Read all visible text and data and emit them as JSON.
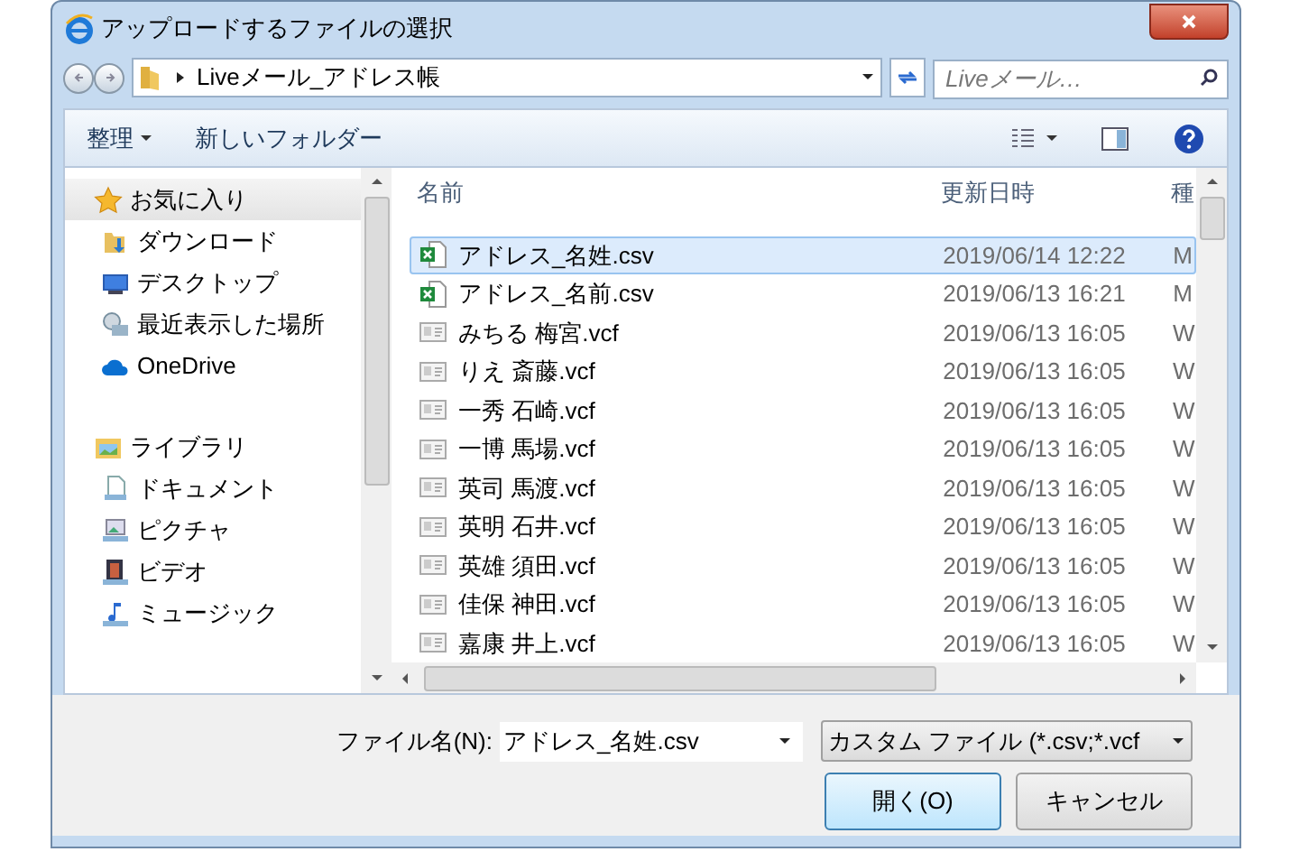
{
  "window": {
    "title": "アップロードするファイルの選択"
  },
  "address": {
    "path": "Liveメール_アドレス帳"
  },
  "search": {
    "placeholder": "Liveメール…"
  },
  "toolbar": {
    "organize": "整理",
    "new_folder": "新しいフォルダー"
  },
  "sidebar": {
    "items": [
      {
        "label": "お気に入り",
        "kind": "star",
        "selected": true,
        "children": [
          {
            "label": "ダウンロード",
            "kind": "download",
            "selected": false
          },
          {
            "label": "デスクトップ",
            "kind": "desktop",
            "selected": false
          },
          {
            "label": "最近表示した場所",
            "kind": "recent",
            "selected": false
          },
          {
            "label": "OneDrive",
            "kind": "cloud",
            "selected": false
          }
        ]
      },
      {
        "label": "ライブラリ",
        "kind": "library",
        "selected": false,
        "children": [
          {
            "label": "ドキュメント",
            "kind": "document",
            "selected": false
          },
          {
            "label": "ピクチャ",
            "kind": "picture",
            "selected": false
          },
          {
            "label": "ビデオ",
            "kind": "video",
            "selected": false
          },
          {
            "label": "ミュージック",
            "kind": "music",
            "selected": false
          }
        ]
      }
    ]
  },
  "table": {
    "columns": [
      "名前",
      "更新日時",
      "種"
    ],
    "rows": [
      {
        "name": "アドレス_名姓.csv",
        "date": "2019/06/14 12:22",
        "column_3": "M",
        "kind": "csv",
        "selected": true
      },
      {
        "name": "アドレス_名前.csv",
        "date": "2019/06/13 16:21",
        "column_3": "M",
        "kind": "csv",
        "selected": false
      },
      {
        "name": "みちる 梅宮.vcf",
        "date": "2019/06/13 16:05",
        "column_3": "W",
        "kind": "vcard",
        "selected": false
      },
      {
        "name": "りえ 斎藤.vcf",
        "date": "2019/06/13 16:05",
        "column_3": "W",
        "kind": "vcard",
        "selected": false
      },
      {
        "name": "一秀 石崎.vcf",
        "date": "2019/06/13 16:05",
        "column_3": "W",
        "kind": "vcard",
        "selected": false
      },
      {
        "name": "一博 馬場.vcf",
        "date": "2019/06/13 16:05",
        "column_3": "W",
        "kind": "vcard",
        "selected": false
      },
      {
        "name": "英司 馬渡.vcf",
        "date": "2019/06/13 16:05",
        "column_3": "W",
        "kind": "vcard",
        "selected": false
      },
      {
        "name": "英明 石井.vcf",
        "date": "2019/06/13 16:05",
        "column_3": "W",
        "kind": "vcard",
        "selected": false
      },
      {
        "name": "英雄 須田.vcf",
        "date": "2019/06/13 16:05",
        "column_3": "W",
        "kind": "vcard",
        "selected": false
      },
      {
        "name": "佳保 神田.vcf",
        "date": "2019/06/13 16:05",
        "column_3": "W",
        "kind": "vcard",
        "selected": false
      },
      {
        "name": "嘉康 井上.vcf",
        "date": "2019/06/13 16:05",
        "column_3": "W",
        "kind": "vcard",
        "selected": false
      }
    ]
  },
  "footer": {
    "filename_label": "ファイル名(N):",
    "filename_value": "アドレス_名姓.csv",
    "filetype": "カスタム ファイル (*.csv;*.vcf",
    "buttons": [
      {
        "label": "開く(O)",
        "kind": "primary"
      },
      {
        "label": "キャンセル",
        "kind": "normal"
      }
    ]
  }
}
